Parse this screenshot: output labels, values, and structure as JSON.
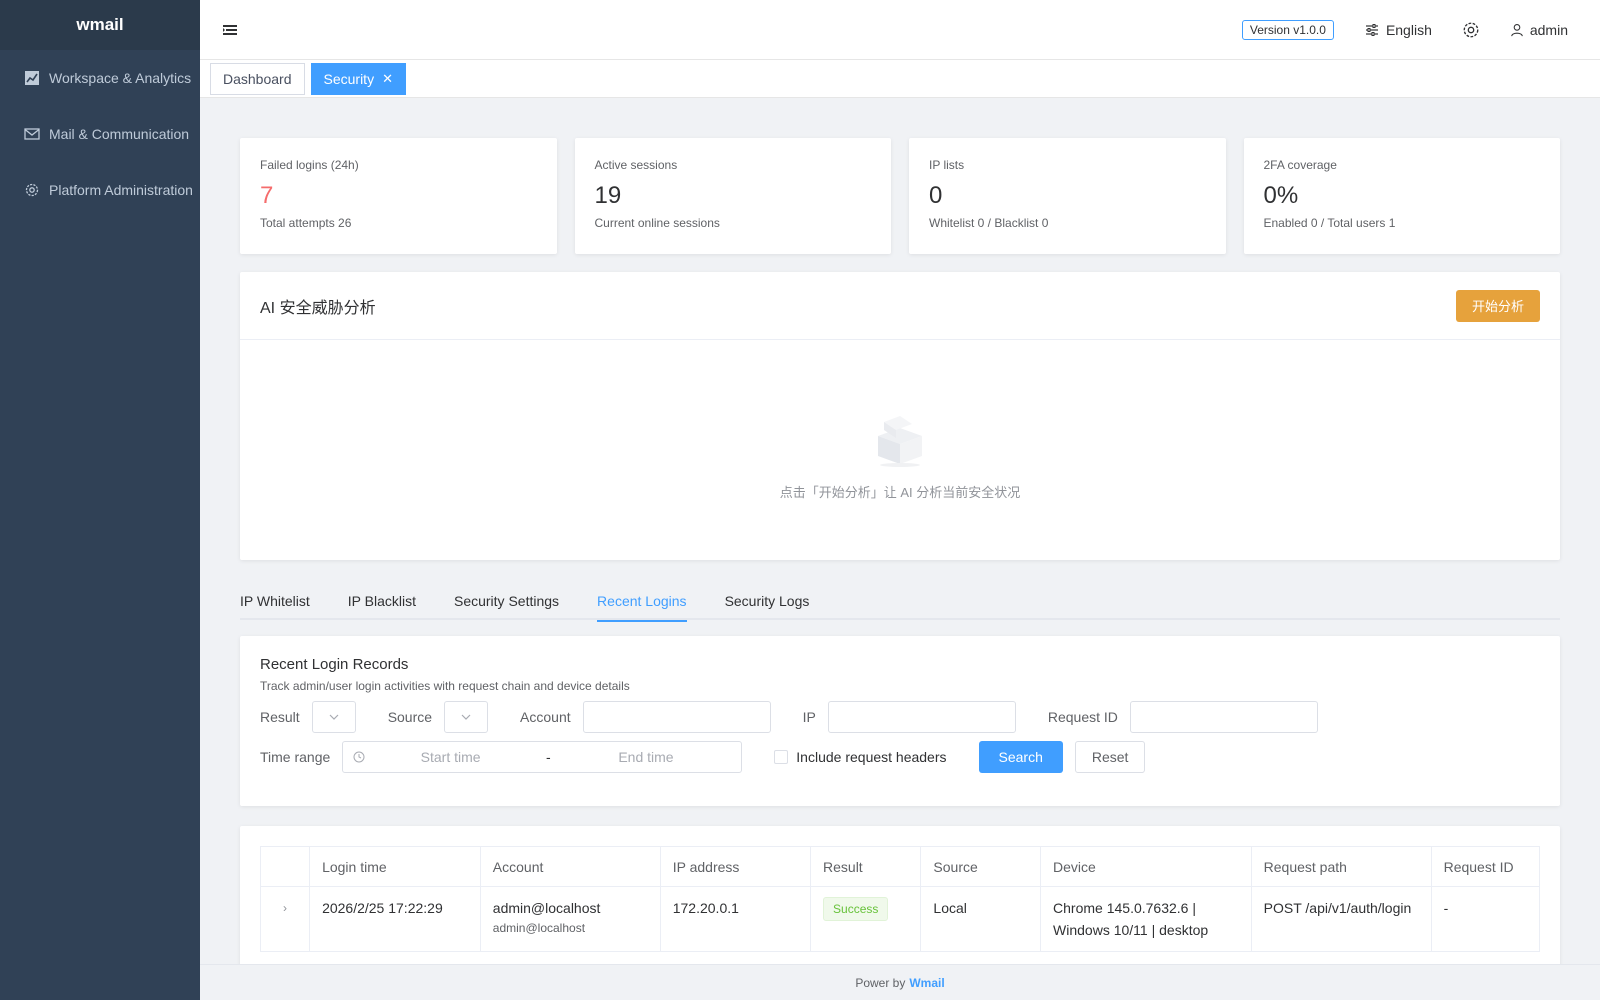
{
  "app": {
    "logo": "wmail"
  },
  "sidebar": {
    "items": [
      {
        "label": "Workspace & Analytics",
        "icon": "chart-icon"
      },
      {
        "label": "Mail & Communication",
        "icon": "mail-icon"
      },
      {
        "label": "Platform Administration",
        "icon": "gear-icon"
      }
    ]
  },
  "navbar": {
    "version": "Version v1.0.0",
    "language": "English",
    "user": "admin"
  },
  "tags": [
    {
      "label": "Dashboard",
      "active": false
    },
    {
      "label": "Security",
      "active": true,
      "close": "✕"
    }
  ],
  "stats": [
    {
      "label": "Failed logins (24h)",
      "value": "7",
      "sub": "Total attempts 26",
      "color": "#f56c6c"
    },
    {
      "label": "Active sessions",
      "value": "19",
      "sub": "Current online sessions"
    },
    {
      "label": "IP lists",
      "value": "0",
      "sub": "Whitelist 0 / Blacklist 0"
    },
    {
      "label": "2FA coverage",
      "value": "0%",
      "sub": "Enabled 0 / Total users 1"
    }
  ],
  "ai": {
    "title": "AI 安全威胁分析",
    "button": "开始分析",
    "empty_text": "点击「开始分析」让 AI 分析当前安全状况"
  },
  "tabs": [
    {
      "label": "IP Whitelist",
      "active": false
    },
    {
      "label": "IP Blacklist",
      "active": false
    },
    {
      "label": "Security Settings",
      "active": false
    },
    {
      "label": "Recent Logins",
      "active": true
    },
    {
      "label": "Security Logs",
      "active": false
    }
  ],
  "filter": {
    "title": "Recent Login Records",
    "desc": "Track admin/user login activities with request chain and device details",
    "result_label": "Result",
    "source_label": "Source",
    "account_label": "Account",
    "ip_label": "IP",
    "request_id_label": "Request ID",
    "time_range_label": "Time range",
    "start_placeholder": "Start time",
    "end_placeholder": "End time",
    "range_sep": "-",
    "include_headers": "Include request headers",
    "search": "Search",
    "reset": "Reset"
  },
  "table": {
    "columns": [
      "",
      "Login time",
      "Account",
      "IP address",
      "Result",
      "Source",
      "Device",
      "Request path",
      "Request ID"
    ],
    "rows": [
      {
        "expand": "›",
        "login_time": "2026/2/25 17:22:29",
        "account": "admin@localhost",
        "account_sub": "admin@localhost",
        "ip": "172.20.0.1",
        "result": "Success",
        "source": "Local",
        "device_line1": "Chrome 145.0.7632.6 |",
        "device_line2": "Windows 10/11 | desktop",
        "path": "POST /api/v1/auth/login",
        "request_id": "-"
      }
    ]
  },
  "footer": {
    "prefix": "Power by",
    "brand": "Wmail"
  },
  "colors": {
    "sidebar": "#304156",
    "primary": "#409eff",
    "warning": "#e6a23c",
    "danger": "#f56c6c",
    "success": "#67c23a"
  }
}
